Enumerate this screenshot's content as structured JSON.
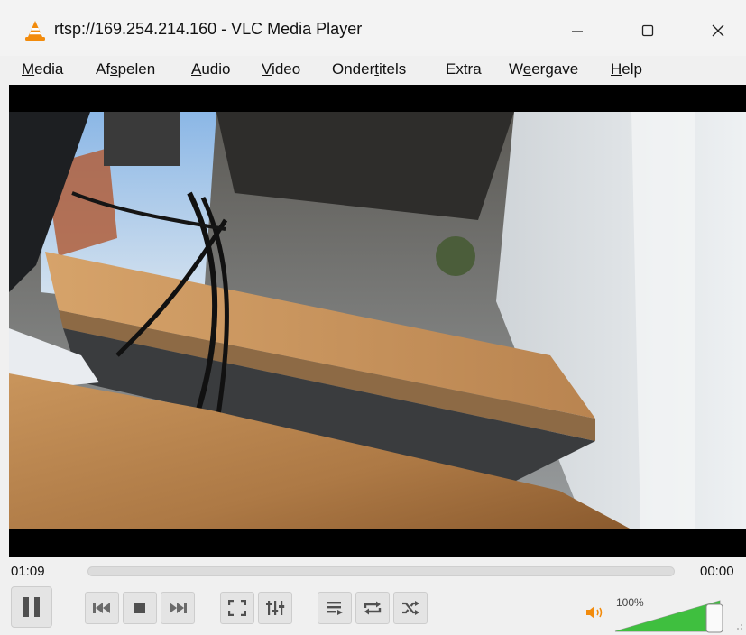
{
  "window": {
    "title": "rtsp://169.254.214.160 - VLC Media Player",
    "minimize_icon": "minimize-icon",
    "maximize_icon": "maximize-icon",
    "close_icon": "close-icon"
  },
  "menu": [
    {
      "pre": "",
      "key": "M",
      "post": "edia"
    },
    {
      "pre": "Af",
      "key": "s",
      "post": "pelen"
    },
    {
      "pre": "",
      "key": "A",
      "post": "udio"
    },
    {
      "pre": "",
      "key": "V",
      "post": "ideo"
    },
    {
      "pre": "Onder",
      "key": "t",
      "post": "itels"
    },
    {
      "pre": "",
      "key": "",
      "post": "Extra"
    },
    {
      "pre": "W",
      "key": "e",
      "post": "ergave"
    },
    {
      "pre": "",
      "key": "H",
      "post": "elp"
    }
  ],
  "playback": {
    "elapsed": "01:09",
    "remaining": "00:00",
    "progress": 0
  },
  "controls": {
    "buttons": [
      "pause-icon",
      "previous-icon",
      "stop-icon",
      "next-icon",
      "fullscreen-icon",
      "extended-settings-icon",
      "playlist-icon",
      "loop-icon",
      "shuffle-icon"
    ]
  },
  "volume": {
    "label": "100%",
    "level": 1.0,
    "icon": "speaker-icon"
  },
  "colors": {
    "vlc_orange": "#f28b0c",
    "volume_green": "#3fbf3f",
    "button_icon": "#505050"
  }
}
